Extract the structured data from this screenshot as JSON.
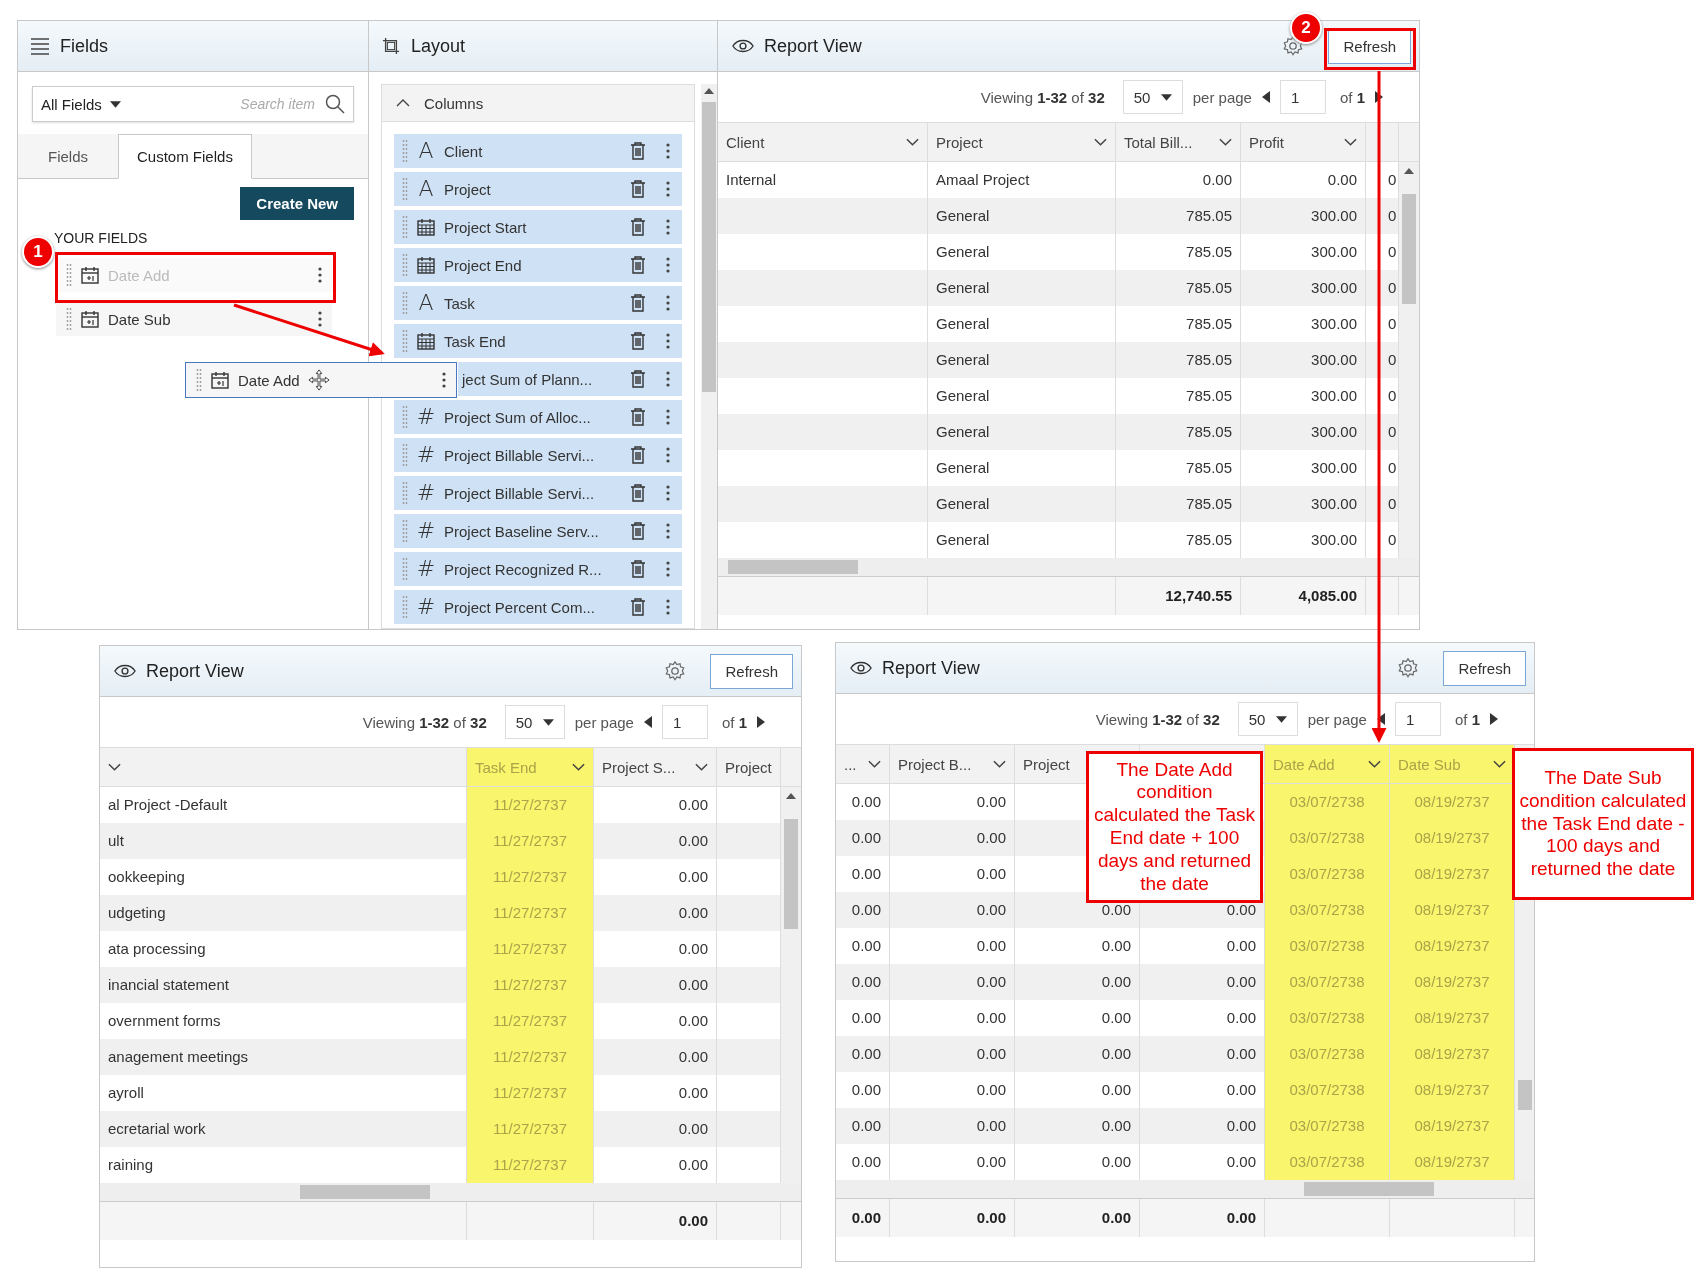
{
  "fields_panel": {
    "title": "Fields",
    "filter": "All Fields",
    "search_placeholder": "Search item",
    "tabs": [
      {
        "label": "Fields",
        "selected": false
      },
      {
        "label": "Custom Fields",
        "selected": true
      }
    ],
    "create_button": "Create New",
    "section_label": "YOUR FIELDS",
    "items": [
      {
        "label": "Date Add",
        "dragging": true
      },
      {
        "label": "Date Sub",
        "dragging": false
      }
    ]
  },
  "drag_item": {
    "label": "Date Add"
  },
  "layout_panel": {
    "title": "Layout",
    "group": "Columns",
    "expanded": true,
    "columns": [
      {
        "label": "Client",
        "kind": "glyph",
        "glyph": "A"
      },
      {
        "label": "Project",
        "kind": "glyph",
        "glyph": "A"
      },
      {
        "label": "Project Start",
        "kind": "date"
      },
      {
        "label": "Project End",
        "kind": "date"
      },
      {
        "label": "Task",
        "kind": "glyph",
        "glyph": "A"
      },
      {
        "label": "Task End",
        "kind": "date"
      },
      {
        "label": "ject Sum of Plann..."
      },
      {
        "label": "Project Sum of Alloc...",
        "kind": "glyph",
        "glyph": "#"
      },
      {
        "label": "Project Billable Servi...",
        "kind": "glyph",
        "glyph": "#"
      },
      {
        "label": "Project Billable Servi...",
        "kind": "glyph",
        "glyph": "#"
      },
      {
        "label": "Project Baseline Serv...",
        "kind": "glyph",
        "glyph": "#"
      },
      {
        "label": "Project Recognized R...",
        "kind": "glyph",
        "glyph": "#"
      },
      {
        "label": "Project Percent Com...",
        "kind": "glyph",
        "glyph": "#"
      }
    ]
  },
  "report_views": [
    {
      "title": "Report View",
      "refresh": "Refresh",
      "viewing": "Viewing **1-32** of **32**",
      "per_page": "50",
      "per_page_label": "per page",
      "page": "1",
      "page_count": "of **1**",
      "columns": [
        {
          "label": "Client",
          "kind": "text",
          "sortable": true,
          "highlighted": false
        },
        {
          "label": "Project",
          "kind": "text",
          "sortable": true,
          "highlighted": false
        },
        {
          "label": "Total Bill...",
          "kind": "number",
          "sortable": true,
          "highlighted": false
        },
        {
          "label": "Profit",
          "kind": "number",
          "sortable": true,
          "highlighted": false
        },
        {
          "kind": "text",
          "sortable": false,
          "highlighted": false
        }
      ],
      "rows": [
        [
          "Internal",
          "Amaal Project",
          "0.00",
          "0.00",
          "0"
        ],
        [
          null,
          "General",
          "785.05",
          "300.00",
          "0"
        ],
        [
          null,
          "General",
          "785.05",
          "300.00",
          "0"
        ],
        [
          null,
          "General",
          "785.05",
          "300.00",
          "0"
        ],
        [
          null,
          "General",
          "785.05",
          "300.00",
          "0"
        ],
        [
          null,
          "General",
          "785.05",
          "300.00",
          "0"
        ],
        [
          null,
          "General",
          "785.05",
          "300.00",
          "0"
        ],
        [
          null,
          "General",
          "785.05",
          "300.00",
          "0"
        ],
        [
          null,
          "General",
          "785.05",
          "300.00",
          "0"
        ],
        [
          null,
          "General",
          "785.05",
          "300.00",
          "0"
        ],
        [
          null,
          "General",
          "785.05",
          "300.00",
          "0"
        ]
      ],
      "totals": [
        "12,740.55",
        "4,085.00"
      ]
    },
    {
      "title": "Report View",
      "refresh": "Refresh",
      "viewing": "Viewing **1-32** of **32**",
      "per_page": "50",
      "per_page_label": "per page",
      "page": "1",
      "page_count": "of **1**",
      "columns": [
        {
          "kind": "text",
          "sortable": true,
          "highlighted": false
        },
        {
          "label": "Task End",
          "kind": "date",
          "sortable": true,
          "highlighted": true
        },
        {
          "label": "Project S...",
          "kind": "number",
          "sortable": true,
          "highlighted": false
        },
        {
          "label": "Project",
          "kind": "text",
          "sortable": false,
          "highlighted": false
        }
      ],
      "rows": [
        [
          "al Project -Default",
          "11/27/2737",
          "0.00",
          null
        ],
        [
          "ult",
          "11/27/2737",
          "0.00",
          null
        ],
        [
          "ookkeeping",
          "11/27/2737",
          "0.00",
          null
        ],
        [
          "udgeting",
          "11/27/2737",
          "0.00",
          null
        ],
        [
          "ata processing",
          "11/27/2737",
          "0.00",
          null
        ],
        [
          "inancial statement",
          "11/27/2737",
          "0.00",
          null
        ],
        [
          "overnment forms",
          "11/27/2737",
          "0.00",
          null
        ],
        [
          "anagement meetings",
          "11/27/2737",
          "0.00",
          null
        ],
        [
          "ayroll",
          "11/27/2737",
          "0.00",
          null
        ],
        [
          "ecretarial work",
          "11/27/2737",
          "0.00",
          null
        ],
        [
          "raining",
          "11/27/2737",
          "0.00",
          null
        ]
      ],
      "totals": [
        "0.00"
      ]
    },
    {
      "title": "Report View",
      "refresh": "Refresh",
      "viewing": "Viewing **1-32** of **32**",
      "per_page": "50",
      "per_page_label": "per page",
      "page": "1",
      "page_count": "of **1**",
      "columns": [
        {
          "label": "...",
          "kind": "number",
          "sortable": true,
          "highlighted": false
        },
        {
          "label": "Project B...",
          "kind": "number",
          "sortable": true,
          "highlighted": false
        },
        {
          "label": "Project",
          "kind": "number",
          "highlighted": false
        },
        {
          "kind": "number",
          "highlighted": false
        },
        {
          "label": "Date Add",
          "kind": "date",
          "sortable": true,
          "highlighted": true
        },
        {
          "label": "Date Sub",
          "kind": "date",
          "sortable": true,
          "highlighted": true
        }
      ],
      "rows": [
        [
          "0.00",
          "0.00",
          null,
          null,
          "03/07/2738",
          "08/19/2737"
        ],
        [
          "0.00",
          "0.00",
          null,
          null,
          "03/07/2738",
          "08/19/2737"
        ],
        [
          "0.00",
          "0.00",
          null,
          null,
          "03/07/2738",
          "08/19/2737"
        ],
        [
          "0.00",
          "0.00",
          "0.00",
          "0.00",
          "03/07/2738",
          "08/19/2737"
        ],
        [
          "0.00",
          "0.00",
          "0.00",
          "0.00",
          "03/07/2738",
          "08/19/2737"
        ],
        [
          "0.00",
          "0.00",
          "0.00",
          "0.00",
          "03/07/2738",
          "08/19/2737"
        ],
        [
          "0.00",
          "0.00",
          "0.00",
          "0.00",
          "03/07/2738",
          "08/19/2737"
        ],
        [
          "0.00",
          "0.00",
          "0.00",
          "0.00",
          "03/07/2738",
          "08/19/2737"
        ],
        [
          "0.00",
          "0.00",
          "0.00",
          "0.00",
          "03/07/2738",
          "08/19/2737"
        ],
        [
          "0.00",
          "0.00",
          "0.00",
          "0.00",
          "03/07/2738",
          "08/19/2737"
        ],
        [
          "0.00",
          "0.00",
          "0.00",
          "0.00",
          "03/07/2738",
          "08/19/2737"
        ]
      ],
      "totals": [
        "0.00",
        "0.00",
        "0.00",
        "0.00"
      ]
    }
  ],
  "step_badges": [
    "1",
    "2"
  ],
  "callouts": [
    "The Date Add condition calculated the Task End date + 100 days and returned the date",
    "The Date Sub condition calculated the Task End date - 100 days and returned the date"
  ]
}
